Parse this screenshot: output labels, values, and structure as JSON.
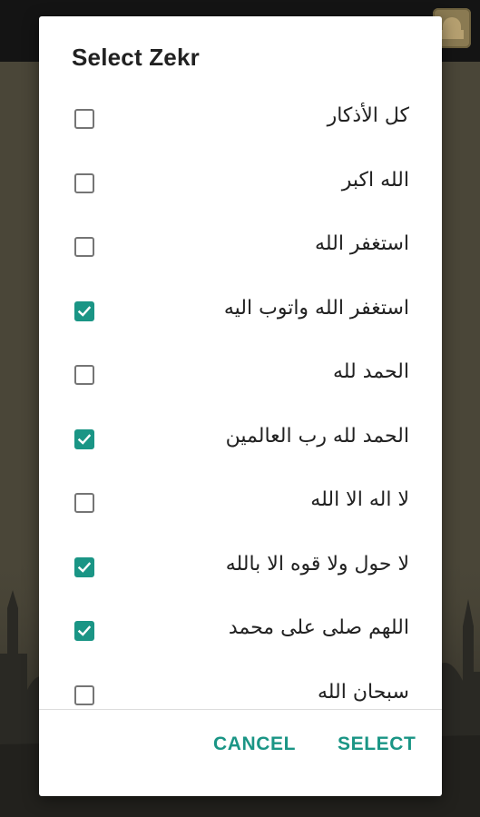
{
  "dialog": {
    "title": "Select Zekr",
    "items": [
      {
        "label": "كل الأذكار",
        "checked": false
      },
      {
        "label": "الله اكبر",
        "checked": false
      },
      {
        "label": "استغفر الله",
        "checked": false
      },
      {
        "label": "استغفر الله واتوب اليه",
        "checked": true
      },
      {
        "label": "الحمد لله",
        "checked": false
      },
      {
        "label": "الحمد لله رب العالمين",
        "checked": true
      },
      {
        "label": "لا اله الا الله",
        "checked": false
      },
      {
        "label": "لا حول ولا قوه الا بالله",
        "checked": true
      },
      {
        "label": "اللهم صلى على محمد",
        "checked": true
      },
      {
        "label": "سبحان الله",
        "checked": false
      }
    ],
    "cancel_label": "CANCEL",
    "select_label": "SELECT"
  },
  "colors": {
    "accent": "#1a9585",
    "text": "#212121",
    "checkbox_border": "#757575"
  },
  "icons": {
    "checked": "check-icon",
    "app": "mosque-app-icon"
  }
}
